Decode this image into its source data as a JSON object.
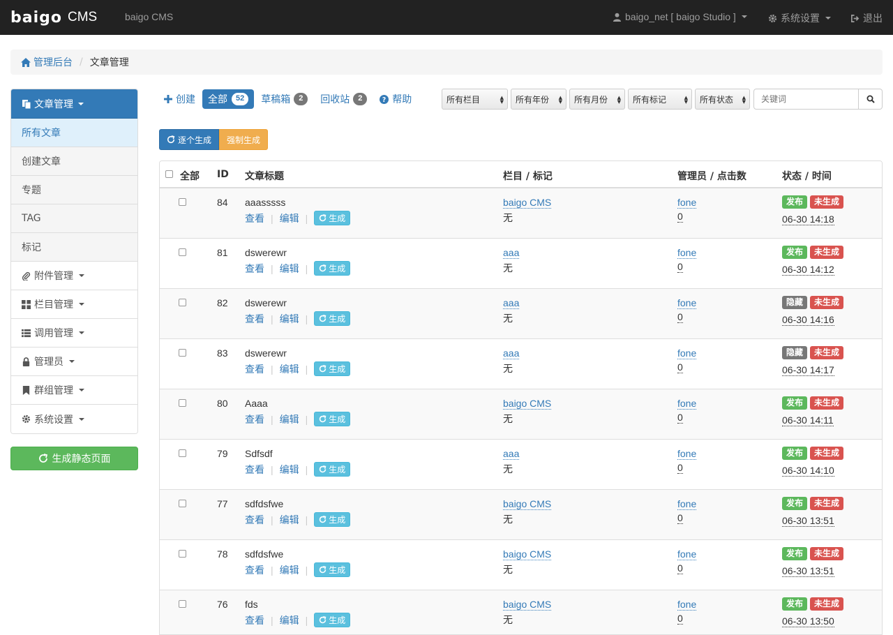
{
  "navbar": {
    "logo": "baigo",
    "logo_suffix": "CMS",
    "site_name": "baigo CMS",
    "user": "baigo_net [ baigo Studio ]",
    "settings": "系统设置",
    "logout": "退出"
  },
  "breadcrumb": {
    "home": "管理后台",
    "current": "文章管理"
  },
  "sidebar": {
    "header": "文章管理",
    "items": [
      {
        "label": "所有文章"
      },
      {
        "label": "创建文章"
      },
      {
        "label": "专题"
      },
      {
        "label": "TAG"
      },
      {
        "label": "标记"
      }
    ],
    "groups": [
      {
        "label": "附件管理",
        "icon": "paperclip-icon"
      },
      {
        "label": "栏目管理",
        "icon": "grid-icon"
      },
      {
        "label": "调用管理",
        "icon": "list-icon"
      },
      {
        "label": "管理员",
        "icon": "lock-icon"
      },
      {
        "label": "群组管理",
        "icon": "bookmark-icon"
      },
      {
        "label": "系统设置",
        "icon": "gear-icon"
      }
    ],
    "generate_static": "生成静态页面"
  },
  "toolbar": {
    "create": "创建",
    "all": "全部",
    "all_count": "52",
    "drafts": "草稿箱",
    "drafts_count": "2",
    "recycle": "回收站",
    "recycle_count": "2",
    "help": "帮助"
  },
  "filters": {
    "column": "所有栏目",
    "year": "所有年份",
    "month": "所有月份",
    "mark": "所有标记",
    "status": "所有状态",
    "search_placeholder": "关键词"
  },
  "generate": {
    "each": "逐个生成",
    "force": "强制生成"
  },
  "table": {
    "headers": {
      "all": "全部",
      "id": "ID",
      "title": "文章标题",
      "category": "栏目 / 标记",
      "admin": "管理员 / 点击数",
      "status": "状态 / 时间"
    },
    "action_view": "查看",
    "action_edit": "编辑",
    "action_gen": "生成",
    "rows": [
      {
        "id": "84",
        "title": "aaasssss",
        "category": "baigo CMS",
        "mark": "无",
        "admin": "fone",
        "hits": "0",
        "status": "发布",
        "gen": "未生成",
        "time": "06-30 14:18"
      },
      {
        "id": "81",
        "title": "dswerewr",
        "category": "aaa",
        "mark": "无",
        "admin": "fone",
        "hits": "0",
        "status": "发布",
        "gen": "未生成",
        "time": "06-30 14:12"
      },
      {
        "id": "82",
        "title": "dswerewr",
        "category": "aaa",
        "mark": "无",
        "admin": "fone",
        "hits": "0",
        "status": "隐藏",
        "gen": "未生成",
        "time": "06-30 14:16"
      },
      {
        "id": "83",
        "title": "dswerewr",
        "category": "aaa",
        "mark": "无",
        "admin": "fone",
        "hits": "0",
        "status": "隐藏",
        "gen": "未生成",
        "time": "06-30 14:17"
      },
      {
        "id": "80",
        "title": "Aaaa",
        "category": "baigo CMS",
        "mark": "无",
        "admin": "fone",
        "hits": "0",
        "status": "发布",
        "gen": "未生成",
        "time": "06-30 14:11"
      },
      {
        "id": "79",
        "title": "Sdfsdf",
        "category": "aaa",
        "mark": "无",
        "admin": "fone",
        "hits": "0",
        "status": "发布",
        "gen": "未生成",
        "time": "06-30 14:10"
      },
      {
        "id": "77",
        "title": "sdfdsfwe",
        "category": "baigo CMS",
        "mark": "无",
        "admin": "fone",
        "hits": "0",
        "status": "发布",
        "gen": "未生成",
        "time": "06-30 13:51"
      },
      {
        "id": "78",
        "title": "sdfdsfwe",
        "category": "baigo CMS",
        "mark": "无",
        "admin": "fone",
        "hits": "0",
        "status": "发布",
        "gen": "未生成",
        "time": "06-30 13:51"
      },
      {
        "id": "76",
        "title": "fds",
        "category": "baigo CMS",
        "mark": "无",
        "admin": "fone",
        "hits": "0",
        "status": "发布",
        "gen": "未生成",
        "time": "06-30 13:50"
      }
    ]
  },
  "colors": {
    "primary": "#337ab7",
    "success": "#5cb85c",
    "danger": "#d9534f",
    "warning": "#f0ad4e",
    "info": "#5bc0de",
    "muted": "#777777",
    "navbar": "#222222"
  }
}
